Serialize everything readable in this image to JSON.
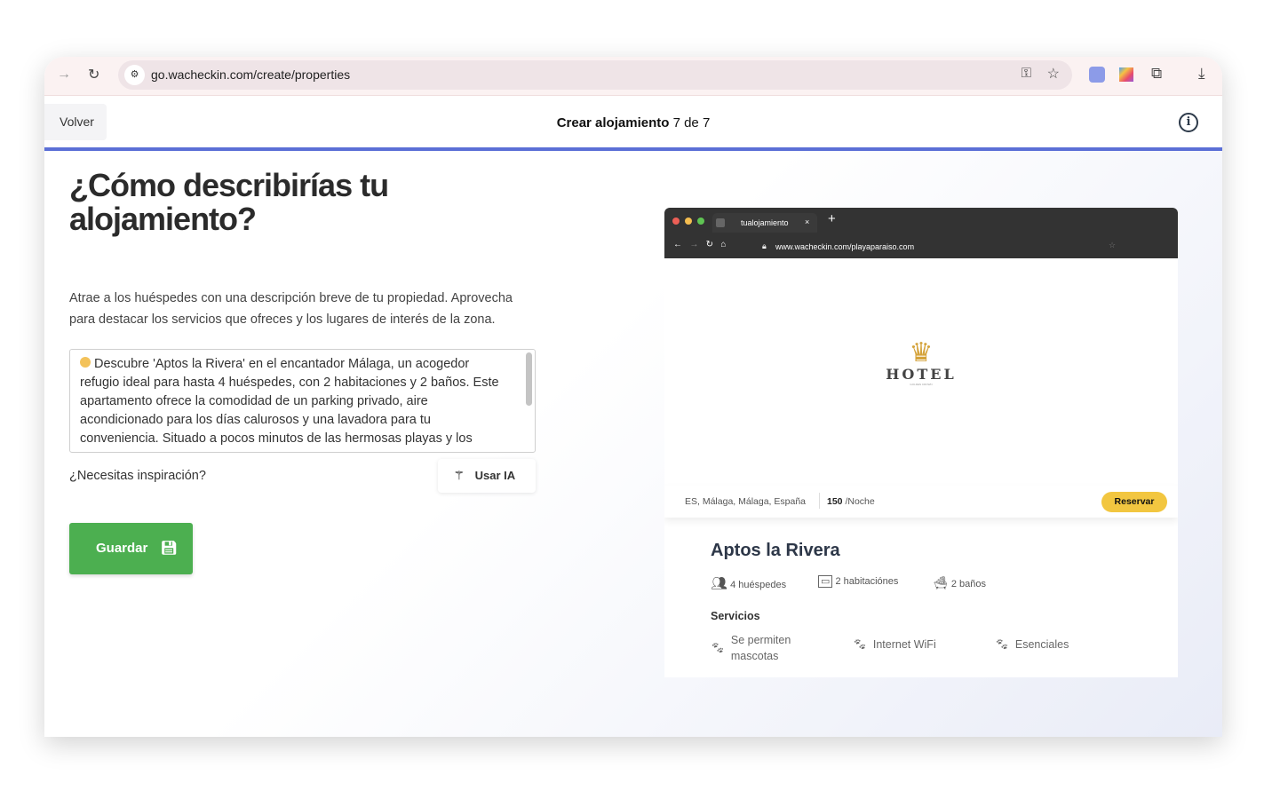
{
  "browser": {
    "url": "go.wacheckin.com/create/properties"
  },
  "header": {
    "back_label": "Volver",
    "title_bold": "Crear alojamiento",
    "title_step": "7 de 7"
  },
  "main": {
    "heading": "¿Cómo describirías tu alojamiento?",
    "subtitle": "Atrae a los huéspedes con una descripción breve de tu propiedad. Aprovecha para destacar los servicios que ofreces y los lugares de interés de la zona.",
    "description": "Descubre 'Aptos la Rivera' en el encantador Málaga, un acogedor refugio ideal para hasta 4 huéspedes, con 2 habitaciones y 2 baños. Este apartamento ofrece la comodidad de un parking privado, aire acondicionado para los días calurosos y una lavadora para tu conveniencia. Situado a pocos minutos de las hermosas playas y los",
    "inspiration_label": "¿Necesitas inspiración?",
    "ai_button": "Usar IA",
    "save_button": "Guardar"
  },
  "preview": {
    "tab_title": "tualojamiento",
    "url": "www.wacheckin.com/playaparaiso.com",
    "logo_text": "HOTEL",
    "logo_subtext": "GOLDEN CROWN",
    "location": "ES, Málaga, Málaga, España",
    "price": "150",
    "price_unit": "/Noche",
    "book_button": "Reservar",
    "property_name": "Aptos la Rivera",
    "guests": "4 huéspedes",
    "rooms": "2 habitaciónes",
    "baths": "2 baños",
    "services_title": "Servicios",
    "services": [
      "Se permiten mascotas",
      "Internet WiFi",
      "Esenciales"
    ]
  },
  "colors": {
    "accent": "#5b6fd6",
    "save": "#4caf50",
    "book": "#f2c640"
  }
}
